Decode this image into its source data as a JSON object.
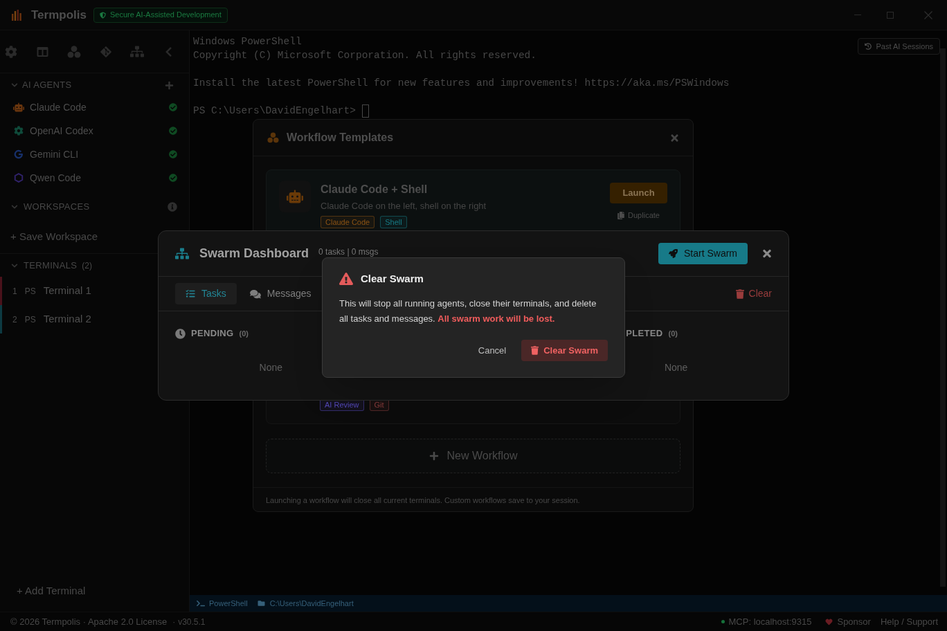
{
  "title_bar": {
    "app_name": "Termpolis",
    "badge": "Secure AI-Assisted Development"
  },
  "sidebar": {
    "agents": {
      "title": "AI AGENTS",
      "expanded": true,
      "items": [
        {
          "name": "Claude Code",
          "kind": "claude",
          "ready": true
        },
        {
          "name": "OpenAI Codex",
          "kind": "codex",
          "ready": true
        },
        {
          "name": "Gemini CLI",
          "kind": "gemini",
          "ready": true
        },
        {
          "name": "Qwen Code",
          "kind": "qwen",
          "ready": true
        }
      ]
    },
    "workspaces": {
      "title": "WORKSPACES",
      "expanded": true,
      "save_label": "+ Save Workspace"
    },
    "terminals": {
      "title": "TERMINALS",
      "count": "(2)",
      "expanded": true,
      "items": [
        {
          "number": "1",
          "shell": "PS",
          "name": "Terminal 1",
          "color": "#4a121b"
        },
        {
          "number": "2",
          "shell": "PS",
          "name": "Terminal 2",
          "color": "#0d3a42"
        }
      ]
    },
    "add_terminal": "+ Add Terminal"
  },
  "terminal": {
    "output_blocks": [
      [
        "Windows PowerShell",
        "Copyright (C) Microsoft Corporation. All rights reserved."
      ],
      [
        "Install the latest PowerShell for new features and improvements! https://aka.ms/PSWindows"
      ]
    ],
    "prompt": "PS C:\\Users\\DavidEngelhart>",
    "past_sessions_button": "Past AI Sessions"
  },
  "terminal_status": {
    "shell": "PowerShell",
    "path": "C:\\Users\\DavidEngelhart"
  },
  "footer": {
    "copyright": "© 2026 Termpolis · Apache 2.0 License",
    "separator": "·",
    "version": "v30.5.1",
    "mcp": "MCP: localhost:9315",
    "mcp_connected": true,
    "sponsor": "Sponsor",
    "help": "Help / Support"
  },
  "workflow_templates": {
    "title": "Workflow Templates",
    "templates": [
      {
        "name": "Claude Code + Shell",
        "description": "Claude Code on the left, shell on the right",
        "tags": [
          {
            "label": "Claude Code",
            "color": "#8a5214"
          },
          {
            "label": "Shell",
            "color": "#167a84"
          }
        ],
        "launch": "Launch",
        "duplicate": "Duplicate"
      },
      {
        "tags": [
          {
            "label": "AI Review",
            "color": "#5448b8"
          },
          {
            "label": "Git",
            "color": "#8a3c3c"
          }
        ]
      }
    ],
    "new_workflow": "New Workflow",
    "footnote": "Launching a workflow will close all current terminals. Custom workflows save to your session."
  },
  "swarm_dashboard": {
    "title": "Swarm Dashboard",
    "summary": "0 tasks | 0 msgs",
    "start_button": "Start Swarm",
    "tabs": [
      {
        "label": "Tasks",
        "kind": "tasks",
        "selected": true
      },
      {
        "label": "Messages",
        "kind": "messages",
        "selected": false
      }
    ],
    "clear_button": "Clear",
    "columns": [
      {
        "kind": "pending",
        "title": "PENDING",
        "count": "(0)",
        "empty": "None"
      },
      {
        "kind": "completed",
        "title": "PLETED",
        "count": "(0)",
        "empty": "None"
      }
    ]
  },
  "clear_dialog": {
    "title": "Clear Swarm",
    "message": "This will stop all running agents, close their terminals, and delete all tasks and messages. **All swarm work will be lost.**",
    "cancel": "Cancel",
    "confirm": "Clear Swarm"
  }
}
